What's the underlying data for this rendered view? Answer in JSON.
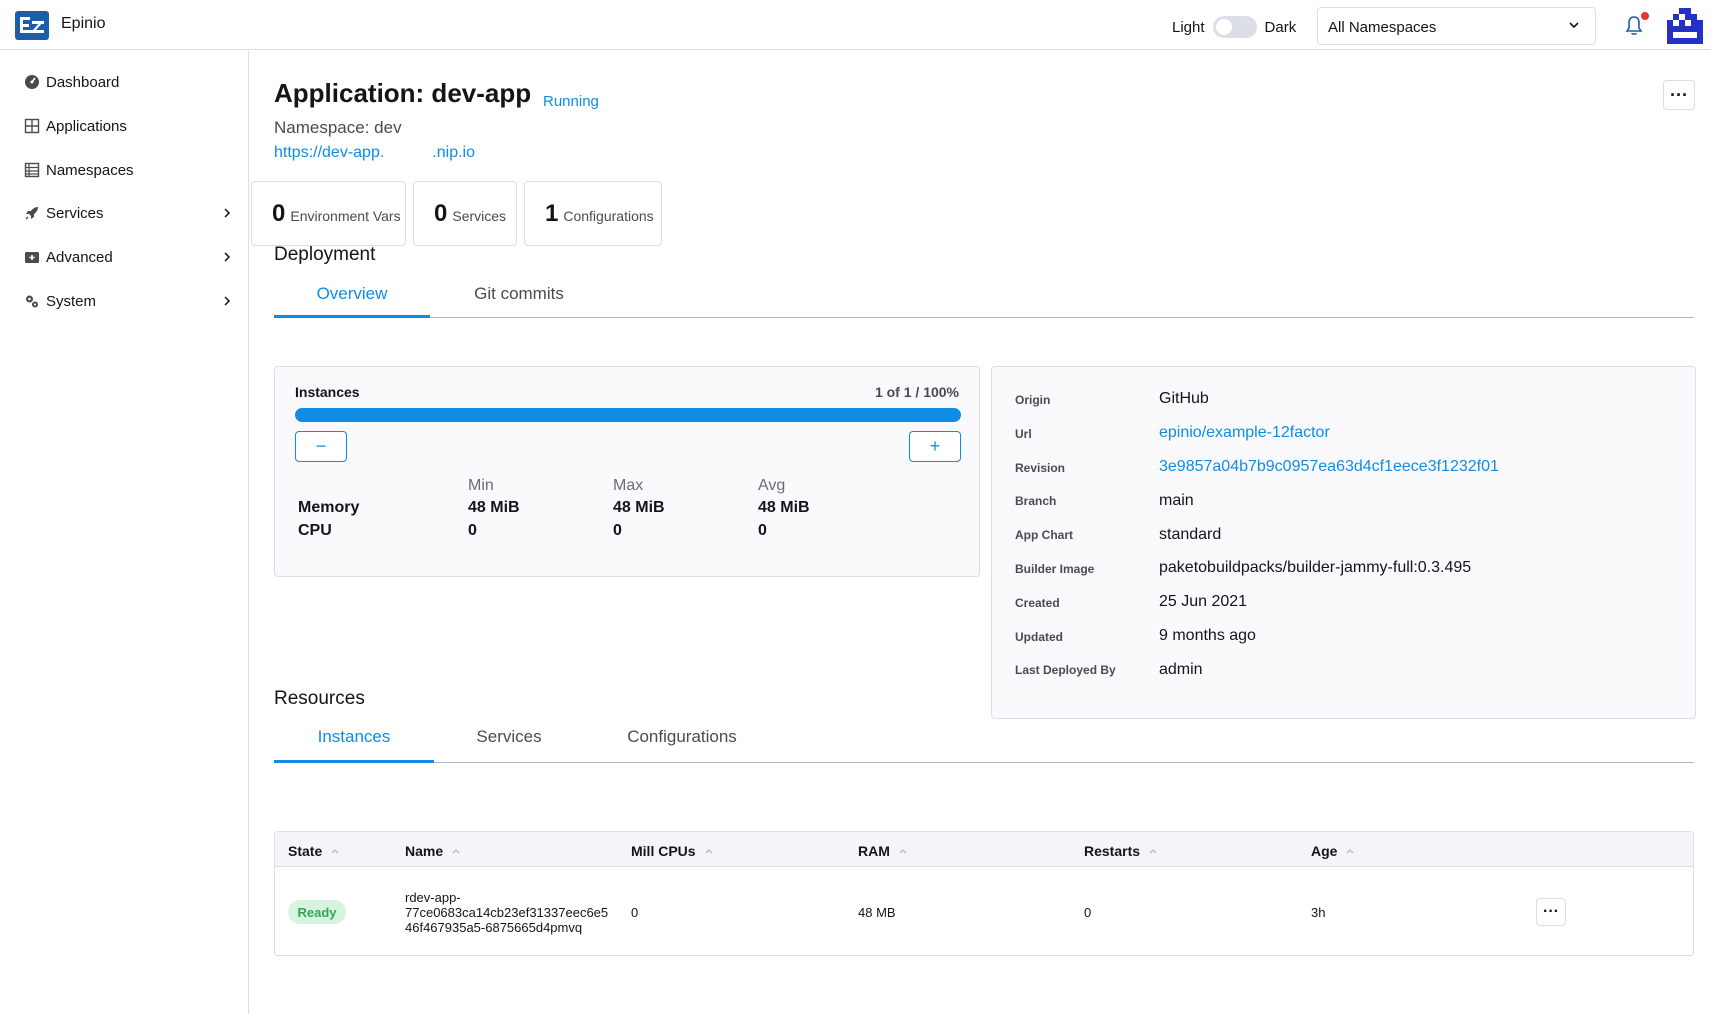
{
  "header": {
    "brand": "Epinio",
    "theme_light": "Light",
    "theme_dark": "Dark",
    "namespace_select": "All Namespaces"
  },
  "sidebar": {
    "items": [
      {
        "label": "Dashboard",
        "icon": "dashboard-icon"
      },
      {
        "label": "Applications",
        "icon": "applications-icon"
      },
      {
        "label": "Namespaces",
        "icon": "namespaces-icon"
      },
      {
        "label": "Services",
        "icon": "rocket-icon",
        "expandable": true
      },
      {
        "label": "Advanced",
        "icon": "advanced-icon",
        "expandable": true
      },
      {
        "label": "System",
        "icon": "gears-icon",
        "expandable": true
      }
    ]
  },
  "app": {
    "title": "Application: dev-app",
    "status": "Running",
    "namespace": "Namespace: dev",
    "url_start": "https://dev-app.",
    "url_end": ".nip.io"
  },
  "counts": [
    {
      "num": "0",
      "label": "Environment Vars"
    },
    {
      "num": "0",
      "label": "Services"
    },
    {
      "num": "1",
      "label": "Configurations"
    }
  ],
  "deployment": {
    "heading": "Deployment",
    "tabs": [
      "Overview",
      "Git commits"
    ],
    "active_tab": 0,
    "instances": {
      "title": "Instances",
      "ratio": "1 of 1 / 100%",
      "progress_percent": 100,
      "minus": "−",
      "plus": "+",
      "headers": [
        "Min",
        "Max",
        "Avg"
      ],
      "rows": [
        {
          "label": "Memory",
          "values": [
            "48 MiB",
            "48 MiB",
            "48 MiB"
          ]
        },
        {
          "label": "CPU",
          "values": [
            "0",
            "0",
            "0"
          ]
        }
      ]
    },
    "details": [
      {
        "label": "Origin",
        "value": "GitHub"
      },
      {
        "label": "Url",
        "value": "epinio/example-12factor",
        "link": true
      },
      {
        "label": "Revision",
        "value": "3e9857a04b7b9c0957ea63d4cf1eece3f1232f01",
        "link": true
      },
      {
        "label": "Branch",
        "value": "main"
      },
      {
        "label": "App Chart",
        "value": "standard"
      },
      {
        "label": "Builder Image",
        "value": "paketobuildpacks/builder-jammy-full:0.3.495"
      },
      {
        "label": "Created",
        "value": "25 Jun 2021"
      },
      {
        "label": "Updated",
        "value": "9 months ago"
      },
      {
        "label": "Last Deployed By",
        "value": "admin"
      }
    ]
  },
  "resources": {
    "heading": "Resources",
    "tabs": [
      "Instances",
      "Services",
      "Configurations"
    ],
    "active_tab": 0,
    "table": {
      "columns": [
        "State",
        "Name",
        "Mill CPUs",
        "RAM",
        "Restarts",
        "Age"
      ],
      "rows": [
        {
          "state": "Ready",
          "name_lines": [
            "rdev-app-",
            "77ce0683ca14cb23ef31337eec6e5",
            "46f467935a5-6875665d4pmvq"
          ],
          "cpus": "0",
          "ram": "48 MB",
          "restarts": "0",
          "age": "3h"
        }
      ]
    }
  },
  "colors": {
    "accent": "#0f8ce6",
    "ready_bg": "#d6f5df",
    "ready_text": "#2fa851",
    "notification_dot": "#e1382e"
  }
}
